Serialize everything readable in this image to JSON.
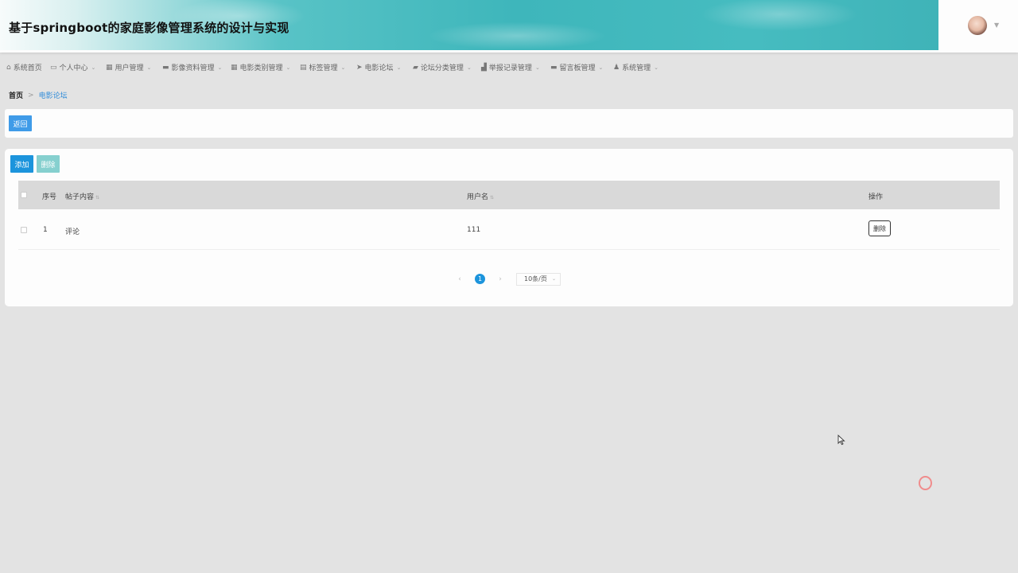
{
  "header": {
    "title": "基于springboot的家庭影像管理系统的设计与实现",
    "avatar_icon": "user-avatar",
    "caret": "▼"
  },
  "nav": {
    "items": [
      {
        "label": "系统首页",
        "icon": "⌂",
        "caret": ""
      },
      {
        "label": "个人中心",
        "icon": "▭",
        "caret": "⌄"
      },
      {
        "label": "用户管理",
        "icon": "▦",
        "caret": "⌄"
      },
      {
        "label": "影像资料管理",
        "icon": "▬",
        "caret": "⌄"
      },
      {
        "label": "电影类别管理",
        "icon": "▦",
        "caret": "⌄"
      },
      {
        "label": "标签管理",
        "icon": "▤",
        "caret": "⌄"
      },
      {
        "label": "电影论坛",
        "icon": "➤",
        "caret": "⌄"
      },
      {
        "label": "论坛分类管理",
        "icon": "▰",
        "caret": "⌄"
      },
      {
        "label": "举报记录管理",
        "icon": "▟",
        "caret": "⌄"
      },
      {
        "label": "留言板管理",
        "icon": "▬",
        "caret": "⌄"
      },
      {
        "label": "系统管理",
        "icon": "♟",
        "caret": "⌄"
      }
    ]
  },
  "breadcrumb": {
    "home": "首页",
    "separator": ">",
    "current": "电影论坛"
  },
  "toolbar": {
    "back_label": "返回",
    "add_label": "添加",
    "delete_label": "删除"
  },
  "table": {
    "headers": {
      "index": "序号",
      "content": "帖子内容",
      "username": "用户名",
      "actions": "操作"
    },
    "sort_glyph": "⇅",
    "rows": [
      {
        "index": "1",
        "content": "评论",
        "username": "111",
        "delete_label": "删除"
      }
    ]
  },
  "pagination": {
    "prev": "‹",
    "current_page": "1",
    "next": "›",
    "page_size": "10条/页",
    "dropdown": "⌄"
  },
  "colors": {
    "primary": "#1c94dc",
    "back_button": "#3f9be8",
    "delete_disabled": "#86d0cf",
    "banner": "#3eb6bb"
  }
}
